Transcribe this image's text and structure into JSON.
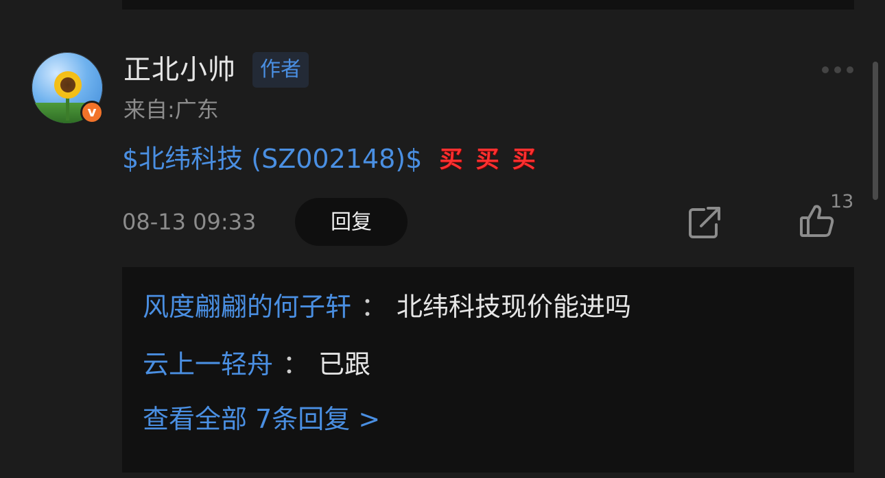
{
  "post": {
    "username": "正北小帅",
    "author_tag": "作者",
    "location": "来自:广东",
    "stock_link": "$北纬科技 (SZ002148)$",
    "emojis": [
      "买",
      "买",
      "买"
    ],
    "timestamp": "08-13 09:33",
    "reply_label": "回复",
    "like_count": "13"
  },
  "replies": [
    {
      "name": "风度翩翩的何子轩",
      "colon": "：",
      "text": "北纬科技现价能进吗"
    },
    {
      "name": "云上一轻舟",
      "colon": "：",
      "text": "已跟"
    }
  ],
  "view_all_label": "查看全部 7条回复 >",
  "colors": {
    "background": "#1c1c1c",
    "card": "#111111",
    "link_blue": "#4a8fe2",
    "secondary_text": "#8c8c8c",
    "emoji_red": "#ff3030",
    "badge_orange": "#f2732a"
  },
  "icons": {
    "avatar": "sunflower-avatar",
    "verified": "verified-badge-icon",
    "more": "more-dots-icon",
    "share": "share-icon",
    "like": "thumbs-up-icon"
  }
}
